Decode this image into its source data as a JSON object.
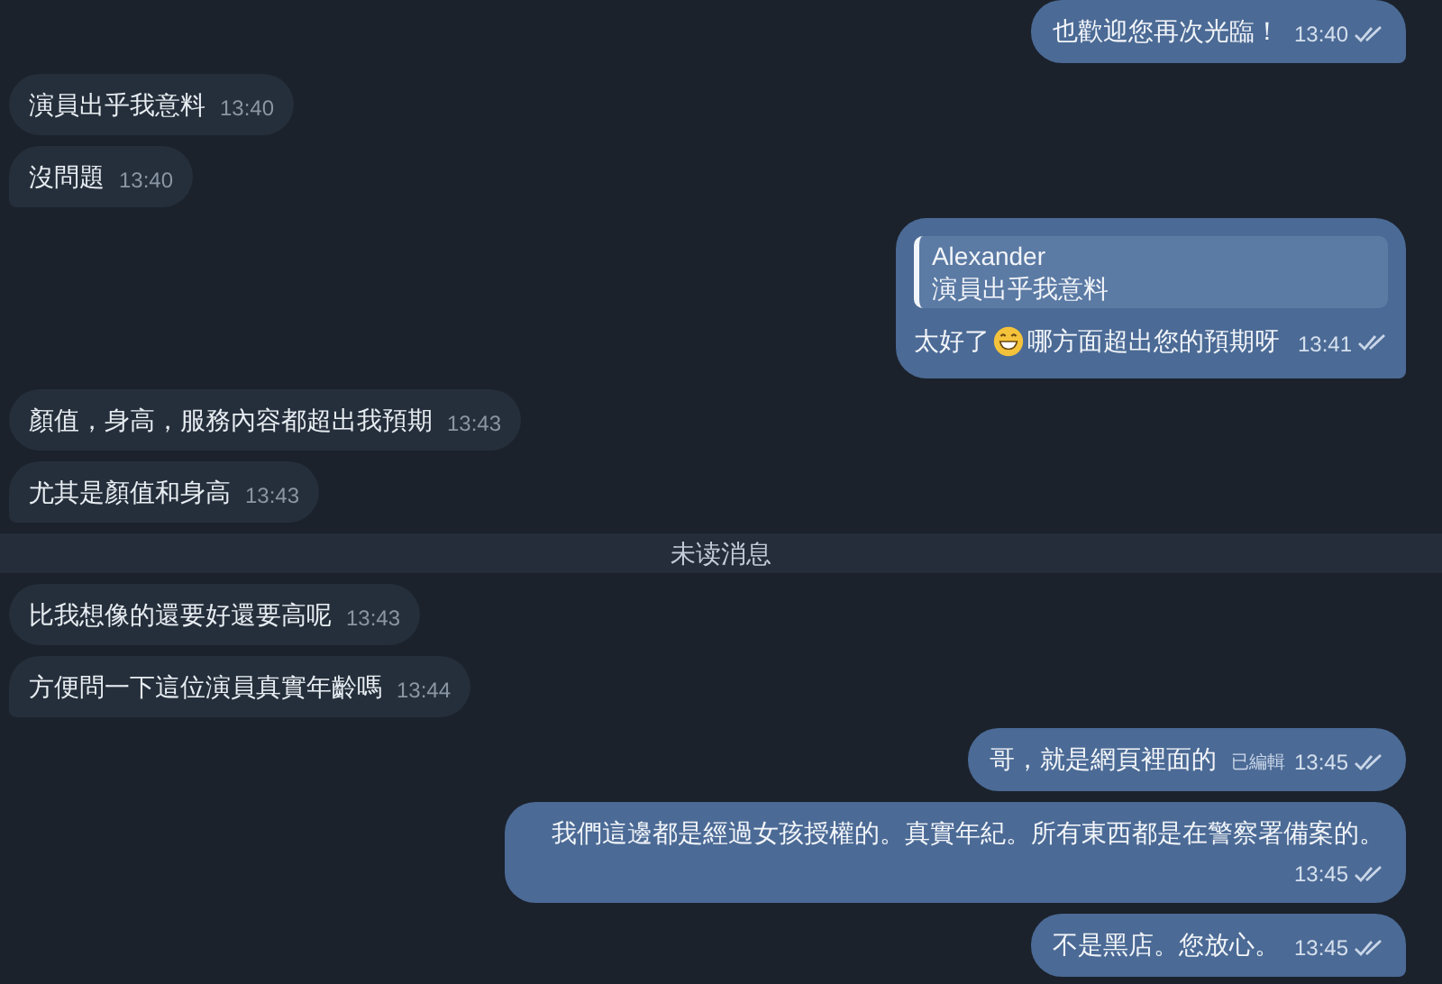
{
  "messages": [
    {
      "kind": "outgoing",
      "text": "也歡迎您再次光臨！",
      "time": "13:40",
      "tail": true
    },
    {
      "kind": "incoming",
      "text": "演員出乎我意料",
      "time": "13:40",
      "tail": false
    },
    {
      "kind": "incoming",
      "text": "沒問題",
      "time": "13:40",
      "tail": true
    },
    {
      "kind": "reply",
      "quote_author": "Alexander",
      "quote_text": "演員出乎我意料",
      "text": "太好了",
      "text_after": "哪方面超出您的預期呀",
      "time": "13:41",
      "tail": true
    },
    {
      "kind": "incoming",
      "text": "顏值，身高，服務內容都超出我預期",
      "time": "13:43",
      "tail": false
    },
    {
      "kind": "incoming",
      "text": "尤其是顏值和身高",
      "time": "13:43",
      "tail": true
    },
    {
      "kind": "divider",
      "text": "未读消息"
    },
    {
      "kind": "incoming",
      "text": "比我想像的還要好還要高呢",
      "time": "13:43",
      "tail": false
    },
    {
      "kind": "incoming",
      "text": "方便問一下這位演員真實年齡嗎",
      "time": "13:44",
      "tail": true
    },
    {
      "kind": "outgoing",
      "text": "哥，就是網頁裡面的",
      "edited": "已編輯",
      "time": "13:45",
      "tail": false
    },
    {
      "kind": "outgoing",
      "text": "我們這邊都是經過女孩授權的。真實年紀。所有東西都是在警察署備案的。",
      "time": "13:45",
      "tail": false
    },
    {
      "kind": "outgoing",
      "text": "不是黑店。您放心。",
      "time": "13:45",
      "tail": true
    }
  ]
}
